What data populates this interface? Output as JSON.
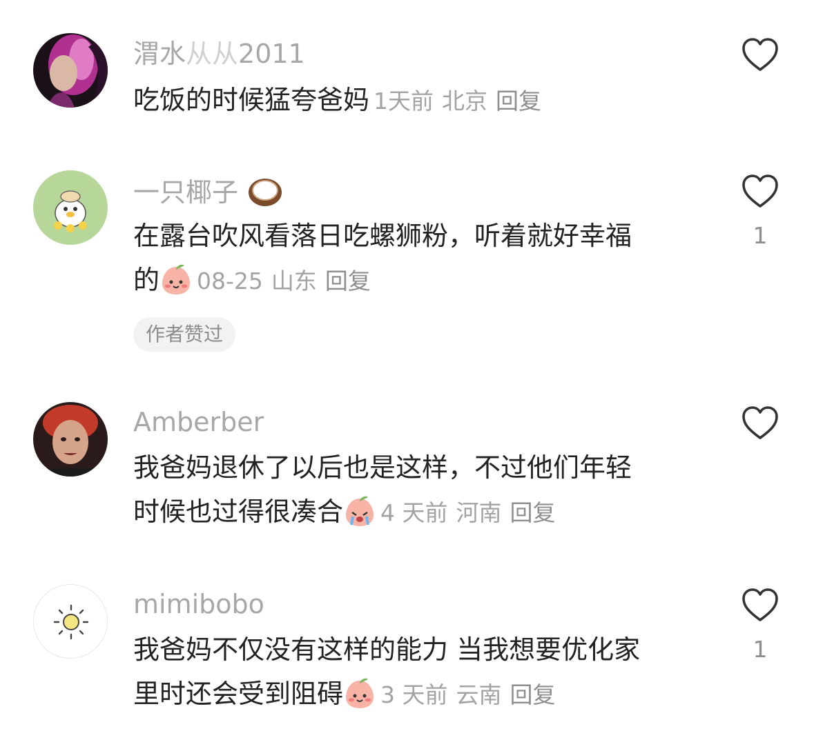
{
  "comments": [
    {
      "username": "渭水",
      "username_suffix": "2011",
      "text_line1": "吃饭的时候猛夸爸妈",
      "text_line2": "",
      "time": "1天前",
      "location": "北京",
      "reply": "回复",
      "like_count": "",
      "avatar": "portrait-pink-hair",
      "emoji": ""
    },
    {
      "username": "一只椰子",
      "text_line1": "在露台吹风看落日吃螺狮粉，听着就好幸福",
      "text_line2": "的",
      "time": "08-25",
      "location": "山东",
      "reply": "回复",
      "like_count": "1",
      "author_liked": "作者赞过",
      "avatar": "duck-cartoon",
      "emoji": "peach-smile",
      "username_emoji": "coconut"
    },
    {
      "username": "Amberber",
      "text_line1": "我爸妈退休了以后也是这样，不过他们年轻",
      "text_line2": "时候也过得很凑合",
      "time": "4 天前",
      "location": "河南",
      "reply": "回复",
      "like_count": "",
      "avatar": "portrait-red-hair",
      "emoji": "peach-crying"
    },
    {
      "username": "mimibobo",
      "text_line1": "我爸妈不仅没有这样的能力 当我想要优化家",
      "text_line2": "里时还会受到阻碍",
      "time": "3 天前",
      "location": "云南",
      "reply": "回复",
      "like_count": "1",
      "avatar": "sun-icon",
      "emoji": "peach-smile"
    }
  ],
  "colors": {
    "username": "#a7a7a7",
    "text": "#222222",
    "meta": "#a3a3a3",
    "badge_bg": "#f2f2f2"
  }
}
